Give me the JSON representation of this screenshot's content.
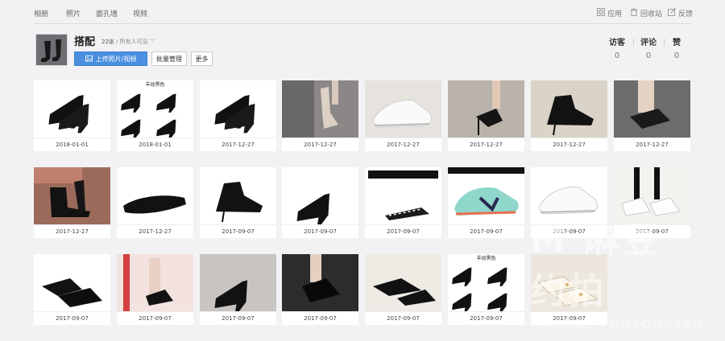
{
  "nav": {
    "tabs": [
      "相册",
      "照片",
      "面孔墙",
      "视频"
    ],
    "right": [
      {
        "label": "应用",
        "icon": "grid-icon"
      },
      {
        "label": "回收站",
        "icon": "trash-icon"
      },
      {
        "label": "反馈",
        "icon": "edit-icon"
      }
    ]
  },
  "album": {
    "title": "搭配",
    "count": "22张",
    "privacy": "/ 所有人可见 ﹀",
    "upload_label": "上传照片/视频",
    "batch_label": "批量管理",
    "more_label": "更多"
  },
  "stats": [
    {
      "label": "访客",
      "value": "0"
    },
    {
      "label": "评论",
      "value": "0"
    },
    {
      "label": "赞",
      "value": "0"
    }
  ],
  "photos": [
    {
      "date": "2018-01-01",
      "scene": "black-pump-white",
      "bg": "#ffffff"
    },
    {
      "date": "2018-01-01",
      "scene": "black-pumps-grid",
      "bg": "#ffffff",
      "caption": "羊纹黑色"
    },
    {
      "date": "2017-12-27",
      "scene": "black-pump-white",
      "bg": "#ffffff"
    },
    {
      "date": "2017-12-27",
      "scene": "nude-heel-photo",
      "bg": "#8a8786"
    },
    {
      "date": "2017-12-27",
      "scene": "white-sneaker",
      "bg": "#e6e3de"
    },
    {
      "date": "2017-12-27",
      "scene": "strappy-heel-photo",
      "bg": "#b9b3ac"
    },
    {
      "date": "2017-12-27",
      "scene": "black-bootie",
      "bg": "#d9d3c8"
    },
    {
      "date": "2017-12-27",
      "scene": "leg-heel-photo",
      "bg": "#6e6c6a"
    },
    {
      "date": "2017-12-27",
      "scene": "ankle-boot-photo",
      "bg": "#9b6a5a"
    },
    {
      "date": "2017-12-27",
      "scene": "black-flat",
      "bg": "#ffffff"
    },
    {
      "date": "2017-09-07",
      "scene": "black-bootie",
      "bg": "#ffffff"
    },
    {
      "date": "2017-09-07",
      "scene": "black-pump-side",
      "bg": "#ffffff"
    },
    {
      "date": "2017-09-07",
      "scene": "sneaker-box",
      "bg": "#ffffff"
    },
    {
      "date": "2017-09-07",
      "scene": "teal-sneaker",
      "bg": "#ffffff"
    },
    {
      "date": "2017-09-07",
      "scene": "white-sneaker",
      "bg": "#ffffff"
    },
    {
      "date": "2017-09-07",
      "scene": "legs-oxford",
      "bg": "#f4f2ef"
    },
    {
      "date": "2017-09-07",
      "scene": "oxford-pair",
      "bg": "#ffffff"
    },
    {
      "date": "2017-09-07",
      "scene": "pink-legs-photo",
      "bg": "#f3e2df"
    },
    {
      "date": "2017-09-07",
      "scene": "black-pump-side",
      "bg": "#c7c4c2"
    },
    {
      "date": "2017-09-07",
      "scene": "dark-heel-photo",
      "bg": "#2c2b2d"
    },
    {
      "date": "2017-09-07",
      "scene": "slingback-photo",
      "bg": "#eeeae4"
    },
    {
      "date": "2017-09-07",
      "scene": "black-pumps-grid",
      "bg": "#ffffff",
      "caption": "羊纹黑色"
    },
    {
      "date": "2017-09-07",
      "scene": "cream-loafer",
      "bg": "#ece6dc"
    }
  ],
  "watermark": {
    "main": "M 麻豆约拍",
    "sub": "MODEL PHOTOGRAPH"
  },
  "colors": {
    "primary_button": "#4a8fe0",
    "background": "#f2f2f4"
  }
}
